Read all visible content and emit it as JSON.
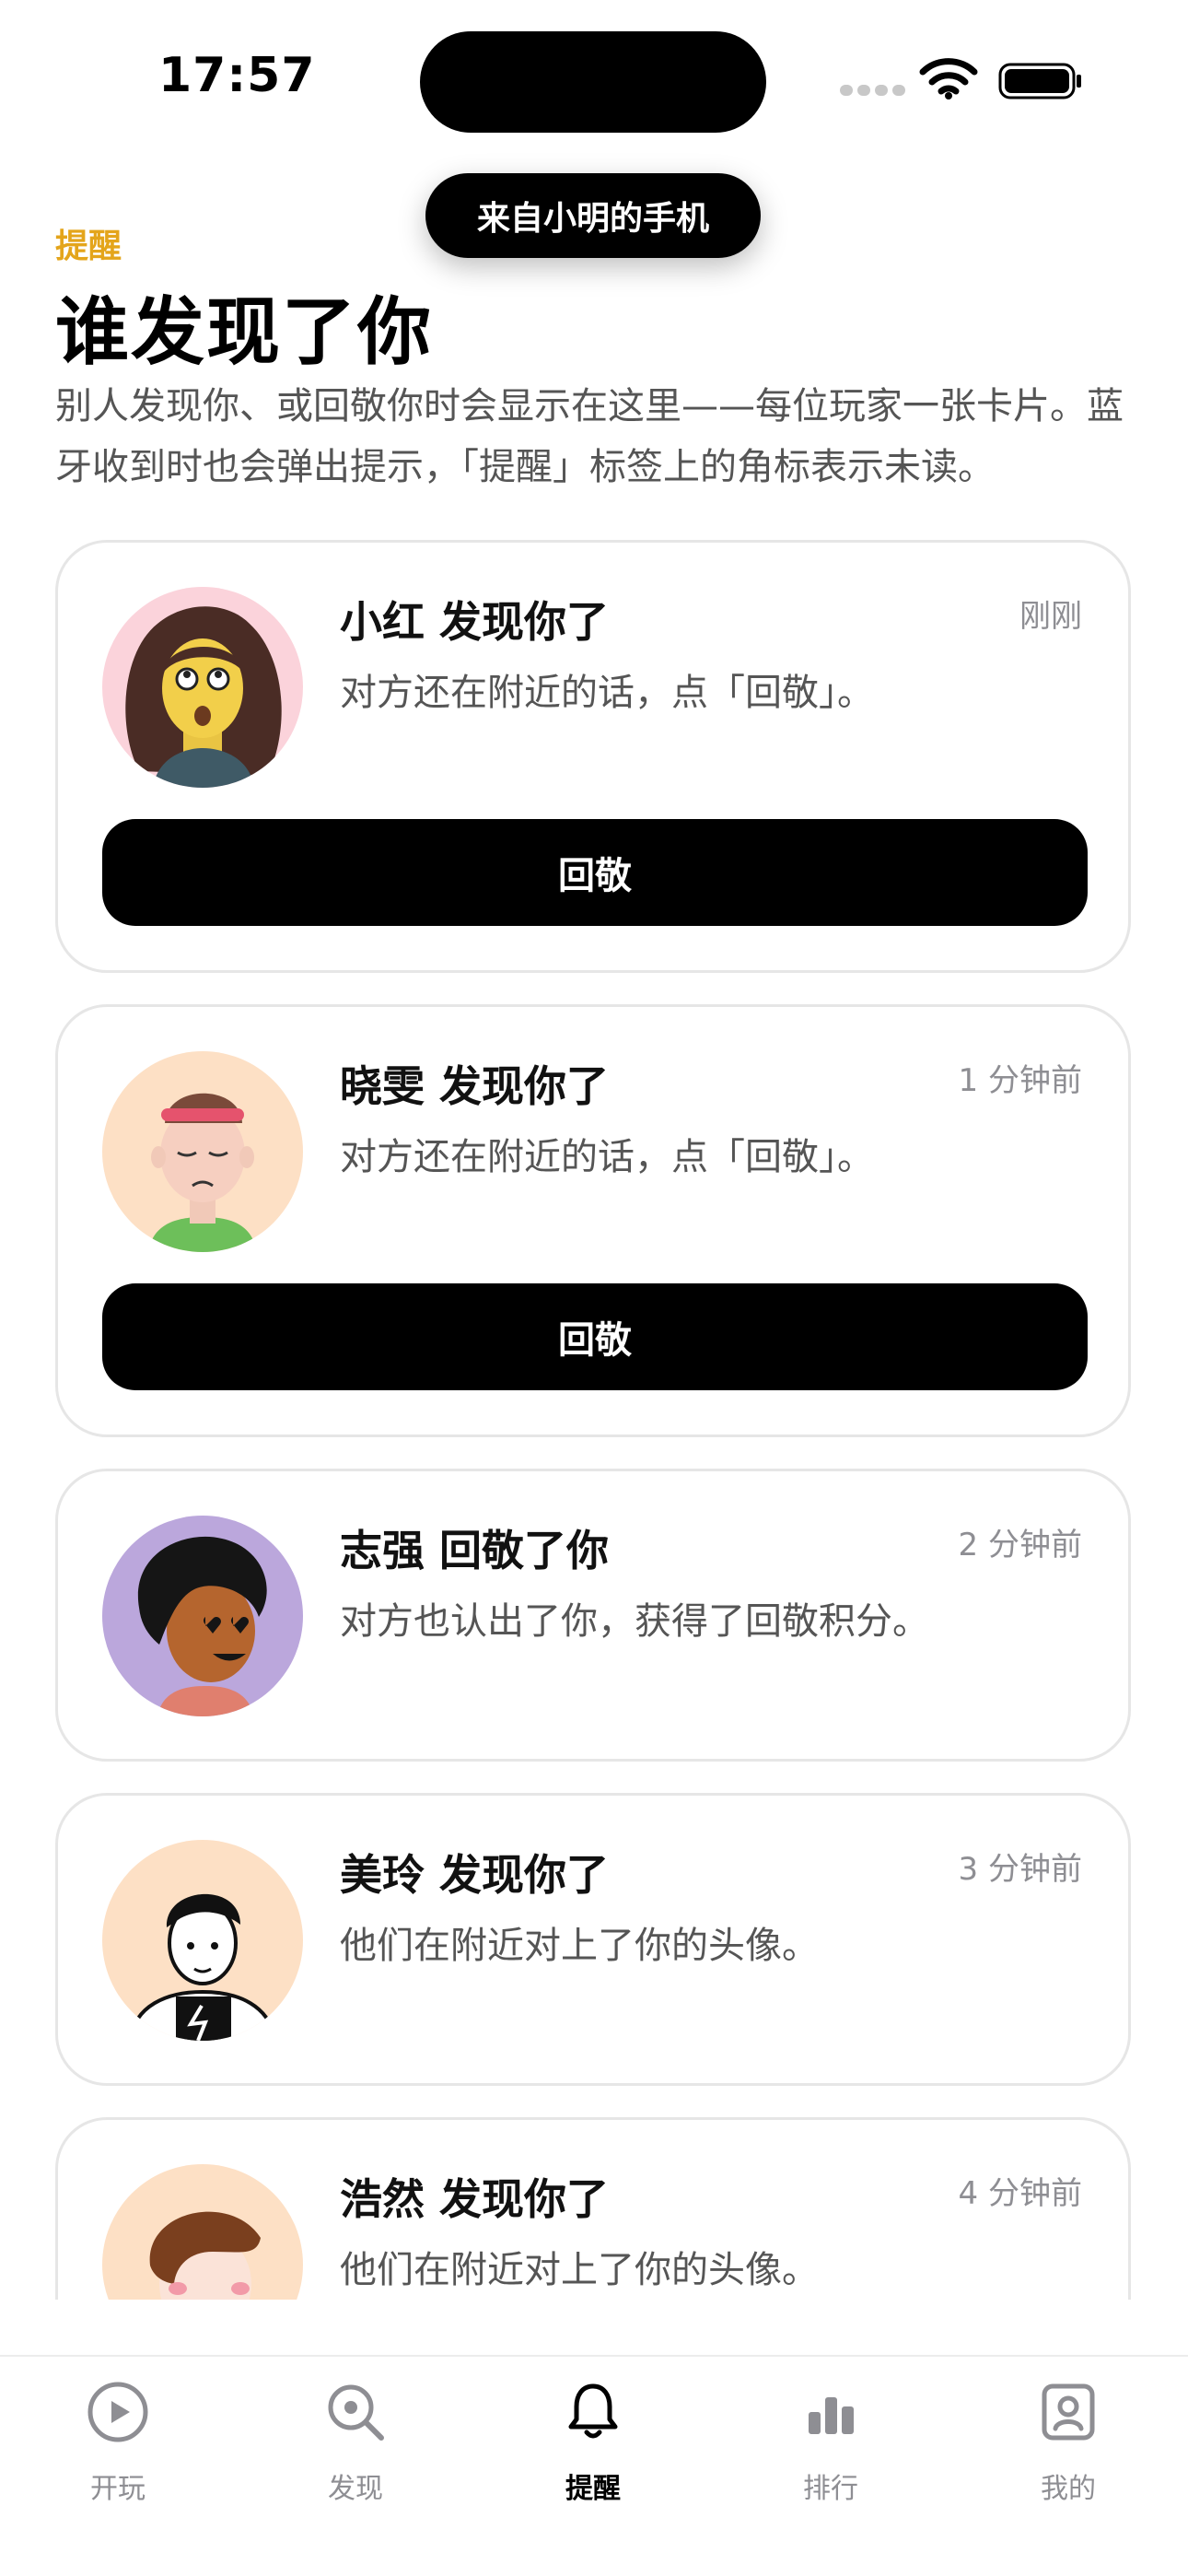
{
  "status_bar": {
    "time": "17:57"
  },
  "toast": {
    "text": "来自小明的手机"
  },
  "header": {
    "eyebrow": "提醒",
    "title": "谁发现了你",
    "description": "别人发现你、或回敬你时会显示在这里——每位玩家一张卡片。蓝牙收到时也会弹出提示，「提醒」标签上的角标表示未读。"
  },
  "notifications": [
    {
      "title": "小红 发现你了",
      "time": "刚刚",
      "subtitle": "对方还在附近的话，点「回敬」。",
      "button": "回敬",
      "avatar_bg": "#fbd3db"
    },
    {
      "title": "晓雯 发现你了",
      "time": "1 分钟前",
      "subtitle": "对方还在附近的话，点「回敬」。",
      "button": "回敬",
      "avatar_bg": "#fde0c5"
    },
    {
      "title": "志强 回敬了你",
      "time": "2 分钟前",
      "subtitle": "对方也认出了你，获得了回敬积分。",
      "avatar_bg": "#bba7dc"
    },
    {
      "title": "美玲 发现你了",
      "time": "3 分钟前",
      "subtitle": "他们在附近对上了你的头像。",
      "avatar_bg": "#fde0c5"
    },
    {
      "title": "浩然 发现你了",
      "time": "4 分钟前",
      "subtitle": "他们在附近对上了你的头像。",
      "avatar_bg": "#fde0c5"
    }
  ],
  "tabbar": {
    "items": [
      {
        "label": "开玩",
        "icon": "play-circle-icon"
      },
      {
        "label": "发现",
        "icon": "search-icon"
      },
      {
        "label": "提醒",
        "icon": "bell-icon",
        "active": true
      },
      {
        "label": "排行",
        "icon": "bar-chart-icon"
      },
      {
        "label": "我的",
        "icon": "profile-icon"
      }
    ]
  },
  "colors": {
    "accent": "#e4a51b",
    "primary": "#000000",
    "muted": "#8e8e93",
    "card_border": "#e6e6e6"
  }
}
